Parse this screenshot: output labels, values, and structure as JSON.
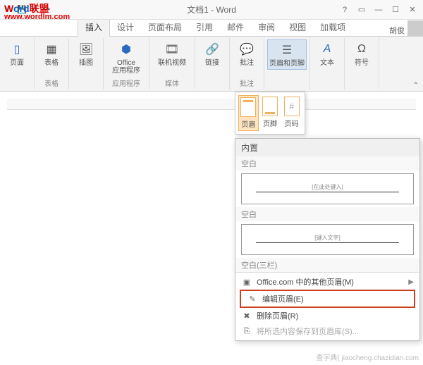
{
  "window": {
    "title": "文档1 - Word"
  },
  "watermarks": {
    "brand_red": "W",
    "brand_blue": "ord",
    "brand_suffix": "联盟",
    "url": "www.wordlm.com",
    "site": "查字典( jiaocheng.chazidian.com"
  },
  "account": {
    "name": "胡俊"
  },
  "tabs": {
    "insert": "插入",
    "design": "设计",
    "layout": "页面布局",
    "references": "引用",
    "mail": "邮件",
    "review": "审阅",
    "view": "视图",
    "addins": "加载项"
  },
  "ribbon": {
    "page": "页面",
    "table": "表格",
    "picture": "插图",
    "office_apps": "Office\n应用程序",
    "office_group": "应用程序",
    "online_video": "联机视频",
    "media_group": "媒体",
    "link": "链接",
    "comment": "批注",
    "header_footer": "页眉和页脚",
    "text": "文本",
    "symbol": "符号"
  },
  "dropdown_items": {
    "header": "页眉",
    "footer": "页脚",
    "pagenum": "页码"
  },
  "header_menu": {
    "builtin": "内置",
    "blank1": "空白",
    "preview1_text": "[在此处键入]",
    "blank2": "空白",
    "preview2_text": "[键入文字]",
    "blank3": "空白(三栏)",
    "office_more": "Office.com 中的其他页眉(M)",
    "edit": "编辑页眉(E)",
    "delete": "删除页眉(R)",
    "save": "将所选内容保存到页眉库(S)..."
  }
}
